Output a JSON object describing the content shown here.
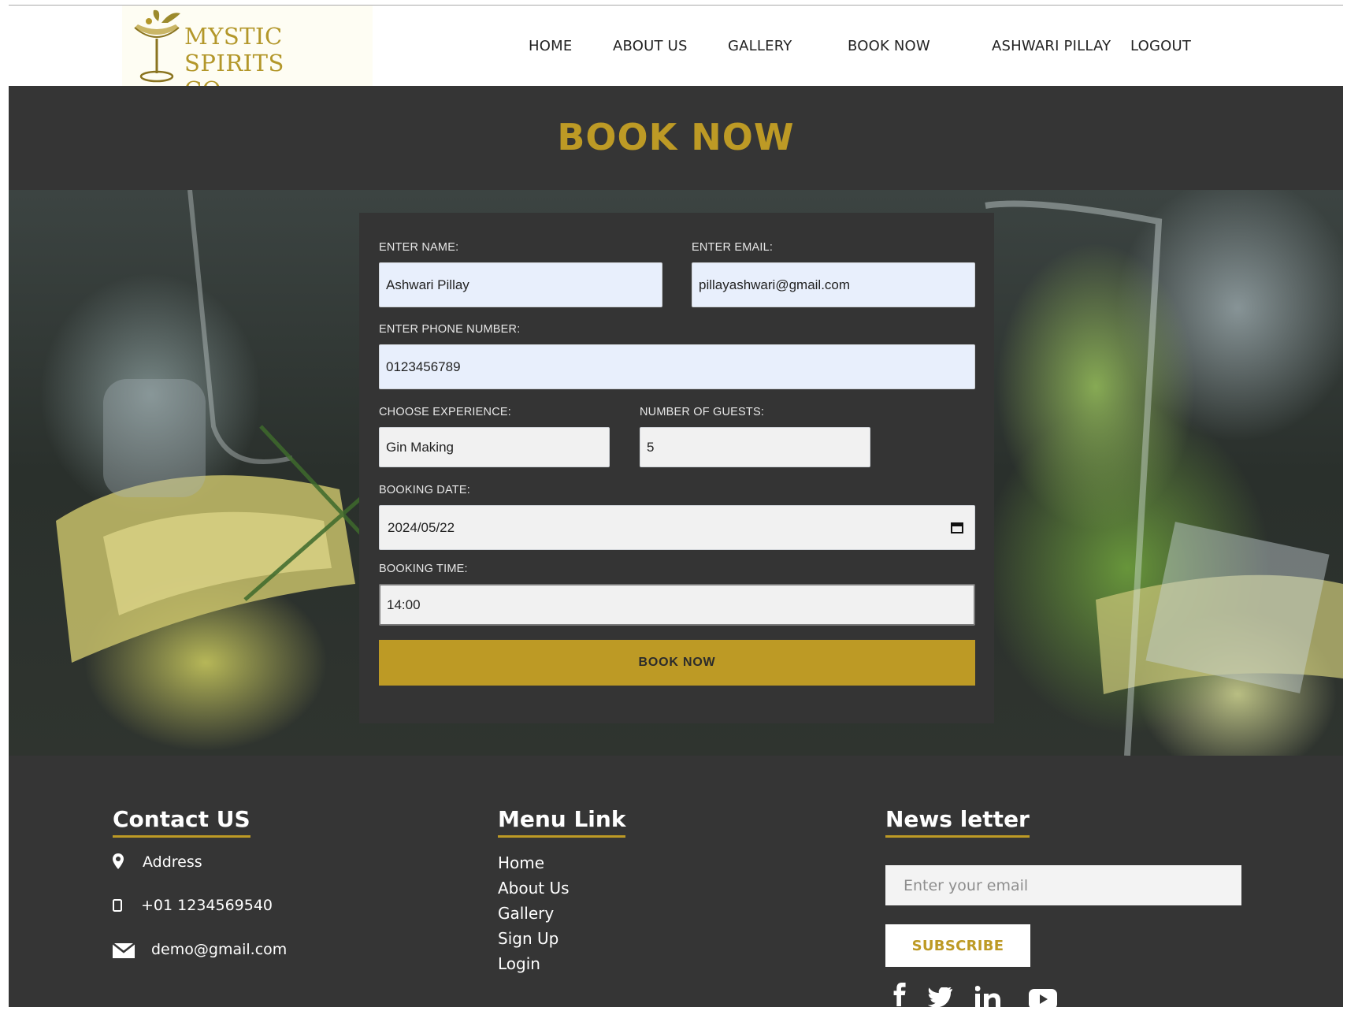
{
  "brand": {
    "logo_text_line1": "MYSTIC SPIRITS",
    "logo_text_line2": "CO.",
    "accent_color": "#bd9a25",
    "dark_bg": "#353535"
  },
  "nav": {
    "items": [
      "HOME",
      "ABOUT US",
      "GALLERY",
      "BOOK NOW"
    ],
    "user_name": "ASHWARI PILLAY",
    "logout_label": "LOGOUT"
  },
  "page_title": "BOOK NOW",
  "form": {
    "name_label": "ENTER NAME:",
    "name_value": "Ashwari Pillay",
    "email_label": "ENTER EMAIL:",
    "email_value": "pillayashwari@gmail.com",
    "phone_label": "ENTER PHONE NUMBER:",
    "phone_value": "0123456789",
    "experience_label": "CHOOSE EXPERIENCE:",
    "experience_value": "Gin Making",
    "guests_label": "NUMBER OF GUESTS:",
    "guests_value": "5",
    "date_label": "BOOKING DATE:",
    "date_value": "2024/05/22",
    "time_label": "BOOKING TIME:",
    "time_value": "14:00",
    "submit_label": "BOOK NOW"
  },
  "footer": {
    "contact": {
      "heading": "Contact US",
      "address": "Address",
      "phone": "+01 1234569540",
      "email": "demo@gmail.com"
    },
    "menu": {
      "heading": "Menu Link",
      "links": [
        "Home",
        "About Us",
        "Gallery",
        "Sign Up",
        "Login"
      ]
    },
    "newsletter": {
      "heading": "News letter",
      "placeholder": "Enter your email",
      "subscribe_label": "SUBSCRIBE"
    },
    "social_icons": [
      "facebook-icon",
      "twitter-icon",
      "linkedin-icon",
      "youtube-icon"
    ]
  }
}
